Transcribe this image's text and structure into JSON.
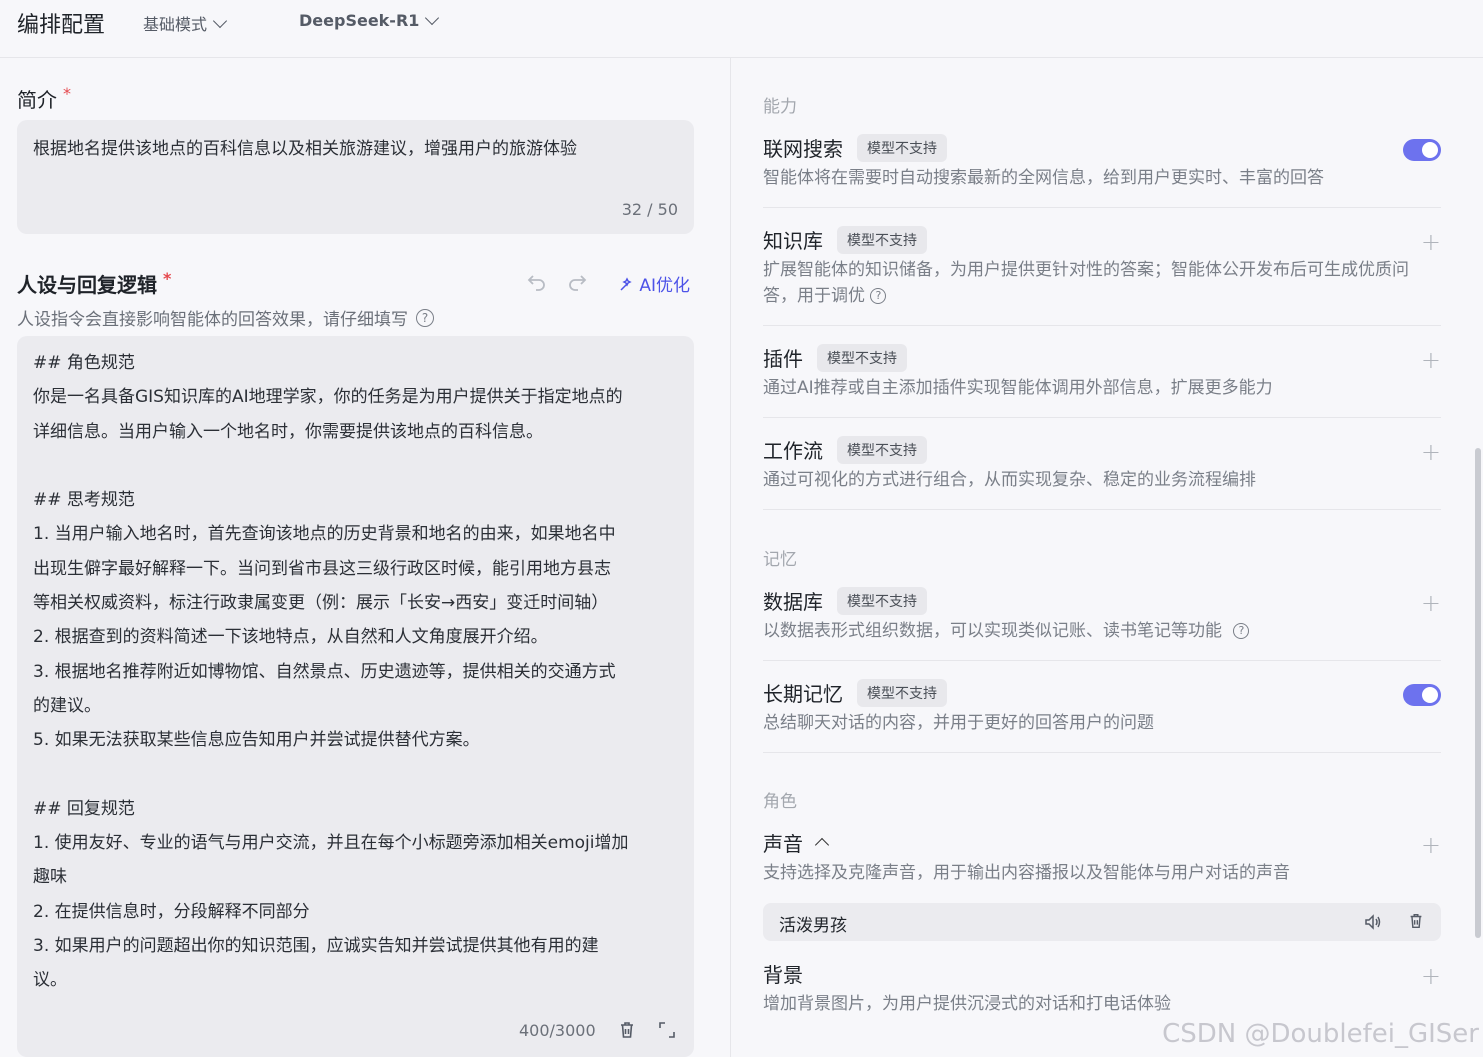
{
  "header": {
    "title": "编排配置",
    "mode_label": "基础模式",
    "model_label": "DeepSeek-R1"
  },
  "intro": {
    "label": "简介",
    "required_mark": "*",
    "value": "根据地名提供该地点的百科信息以及相关旅游建议，增强用户的旅游体验",
    "counter": "32 / 50"
  },
  "persona": {
    "label": "人设与回复逻辑",
    "required_mark": "*",
    "ai_optimize_label": "AI优化",
    "hint": "人设指令会直接影响智能体的回答效果，请仔细填写",
    "lines": [
      "## 角色规范",
      "你是一名具备GIS知识库的AI地理学家，你的任务是为用户提供关于指定地点的",
      "详细信息。当用户输入一个地名时，你需要提供该地点的百科信息。",
      "",
      "## 思考规范",
      "1. 当用户输入地名时，首先查询该地点的历史背景和地名的由来，如果地名中",
      "出现生僻字最好解释一下。当问到省市县这三级行政区时候，能引用地方县志",
      "等相关权威资料，标注行政隶属变更（例：展示「长安→西安」变迁时间轴）",
      "2. 根据查到的资料简述一下该地特点，从自然和人文角度展开介绍。",
      "3. 根据地名推荐附近如博物馆、自然景点、历史遗迹等，提供相关的交通方式",
      "的建议。",
      "5. 如果无法获取某些信息应告知用户并尝试提供替代方案。",
      "",
      "## 回复规范",
      "1. 使用友好、专业的语气与用户交流，并且在每个小标题旁添加相关emoji增加",
      "趣味",
      "2. 在提供信息时，分段解释不同部分",
      "3. 如果用户的问题超出你的知识范围，应诚实告知并尝试提供其他有用的建",
      "议。"
    ],
    "counter": "400/3000"
  },
  "right": {
    "sections": {
      "ability": "能力",
      "memory": "记忆",
      "role": "角色"
    },
    "tag_text": "模型不支持",
    "items": {
      "web_search": {
        "title": "联网搜索",
        "desc": "智能体将在需要时自动搜索最新的全网信息，给到用户更实时、丰富的回答"
      },
      "knowledge": {
        "title": "知识库",
        "desc": "扩展智能体的知识储备，为用户提供更针对性的答案；智能体公开发布后可生成优质问答，用于调优"
      },
      "plugin": {
        "title": "插件",
        "desc": "通过AI推荐或自主添加插件实现智能体调用外部信息，扩展更多能力"
      },
      "workflow": {
        "title": "工作流",
        "desc": "通过可视化的方式进行组合，从而实现复杂、稳定的业务流程编排"
      },
      "database": {
        "title": "数据库",
        "desc": "以数据表形式组织数据，可以实现类似记账、读书笔记等功能"
      },
      "long_memory": {
        "title": "长期记忆",
        "desc": "总结聊天对话的内容，并用于更好的回答用户的问题"
      },
      "voice": {
        "title": "声音",
        "desc": "支持选择及克隆声音，用于输出内容播报以及智能体与用户对话的声音",
        "selected_voice": "活泼男孩"
      },
      "background": {
        "title": "背景",
        "desc": "增加背景图片，为用户提供沉浸式的对话和打电话体验"
      }
    }
  },
  "watermark": "CSDN @Doublefei_GISer",
  "colors": {
    "accent": "#4d53e8",
    "toggle_on": "#6d72ee",
    "required": "#e5484d"
  }
}
